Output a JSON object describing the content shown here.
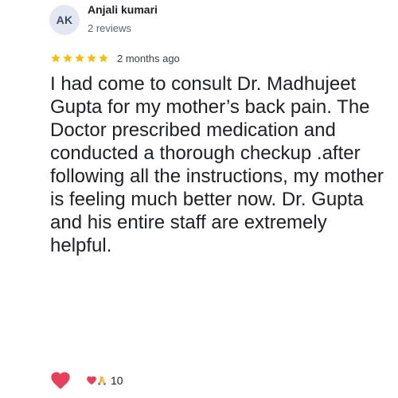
{
  "reviewer": {
    "initials": "AK",
    "name": "Anjali kumari",
    "review_count": "2 reviews"
  },
  "rating": {
    "stars": 5,
    "max_stars": 5,
    "time_ago": "2 months ago"
  },
  "review": {
    "text": "I had come to consult Dr. Madhujeet Gupta for my mother’s back pain. The Doctor prescribed medication and conducted a thorough checkup .after following all the instructions, my mother is feeling much better now. Dr. Gupta and his entire staff are extremely helpful."
  },
  "reactions": {
    "heart_icon": "heart-icon",
    "summary_icons": [
      "heart-icon",
      "folded-hands-icon"
    ],
    "count": "10"
  },
  "colors": {
    "star": "#fbbc04",
    "heart": "#e8405a",
    "avatar_bg": "#e2e7f2",
    "secondary_text": "#5f6368"
  }
}
